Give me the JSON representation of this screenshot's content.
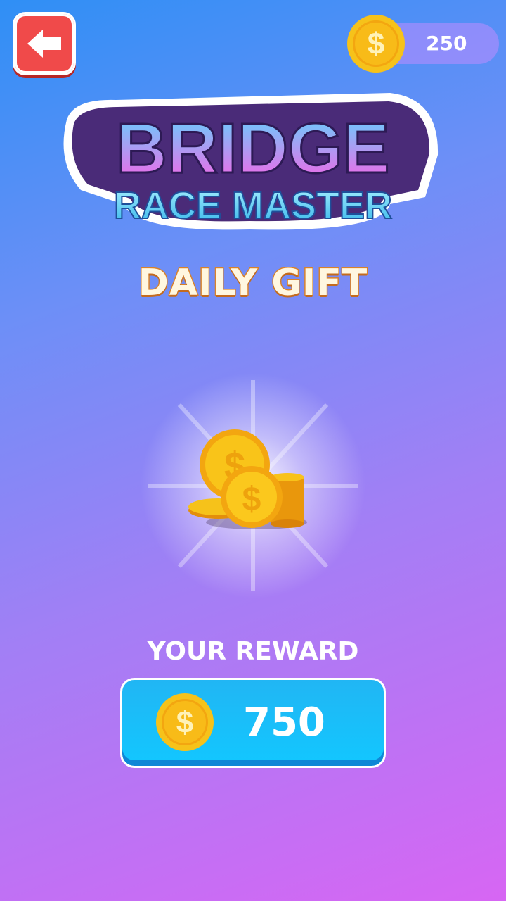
{
  "header": {
    "back_icon": "arrow-left-icon",
    "coin_balance": "250"
  },
  "logo": {
    "line1": "BRIDGE",
    "line2": "RACE MASTER"
  },
  "page": {
    "title": "DAILY GIFT"
  },
  "reward": {
    "label": "YOUR REWARD",
    "amount": "750"
  },
  "colors": {
    "back_button": "#f04a4a",
    "reward_box": "#1ebcf7",
    "coin": "#f7b515",
    "title_stroke": "#d9822b"
  }
}
